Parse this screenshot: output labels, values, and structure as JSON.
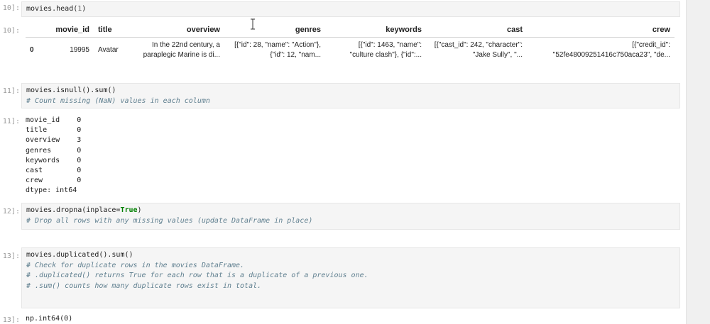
{
  "cells": [
    {
      "in_prompt": "10]:",
      "code": [
        "movies.head(1)"
      ],
      "out_prompt": "10]:",
      "table": {
        "columns": [
          "",
          "movie_id",
          "title",
          "overview",
          "genres",
          "keywords",
          "cast",
          "crew"
        ],
        "rows": [
          {
            "index": "0",
            "movie_id": "19995",
            "title": "Avatar",
            "overview": [
              "In the 22nd century, a",
              "paraplegic Marine is di..."
            ],
            "genres": [
              "[{\"id\": 28, \"name\": \"Action\"},",
              "{\"id\": 12, \"nam..."
            ],
            "keywords": [
              "[{\"id\": 1463, \"name\":",
              "\"culture clash\"}, {\"id\":..."
            ],
            "cast": [
              "[{\"cast_id\": 242, \"character\":",
              "\"Jake Sully\", \"..."
            ],
            "crew": [
              "[{\"credit_id\":",
              "\"52fe48009251416c750aca23\", \"de..."
            ]
          }
        ]
      }
    },
    {
      "in_prompt": "11]:",
      "code": [
        "movies.isnull().sum()",
        "# Count missing (NaN) values in each column"
      ],
      "out_prompt": "11]:",
      "output": [
        "movie_id    0",
        "title       0",
        "overview    3",
        "genres      0",
        "keywords    0",
        "cast        0",
        "crew        0",
        "dtype: int64"
      ]
    },
    {
      "in_prompt": "12]:",
      "code": [
        "movies.dropna(inplace=True)",
        "# Drop all rows with any missing values (update DataFrame in place)"
      ]
    },
    {
      "in_prompt": "13]:",
      "code": [
        "movies.duplicated().sum()",
        "# Check for duplicate rows in the movies DataFrame.",
        "# .duplicated() returns True for each row that is a duplicate of a previous one.",
        "# .sum() counts how many duplicate rows exist in total."
      ],
      "out_prompt": "13]:",
      "output": [
        "np.int64(0)"
      ]
    }
  ],
  "code_tokens": {
    "c1_fn": "movies.head(",
    "c1_num": "1",
    "c1_close": ")",
    "c3_fn": "movies.dropna(inplace=",
    "c3_kw": "True",
    "c3_close": ")"
  }
}
